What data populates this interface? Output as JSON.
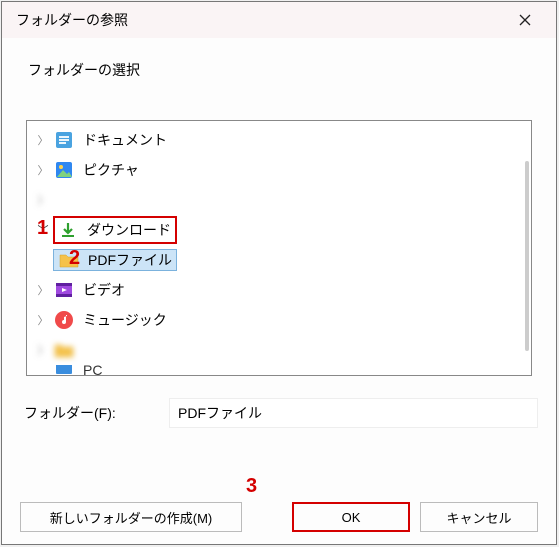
{
  "titlebar": {
    "title": "フォルダーの参照"
  },
  "subtitle": "フォルダーの選択",
  "tree": [
    {
      "label": "ドキュメント",
      "icon": "document",
      "expander": "closed",
      "indent": 0
    },
    {
      "label": "ピクチャ",
      "icon": "pictures",
      "expander": "closed",
      "indent": 0
    },
    {
      "label": "　　　　　",
      "icon": "blank",
      "expander": "closed",
      "indent": 0,
      "blur": true
    },
    {
      "label": "ダウンロード",
      "icon": "download",
      "expander": "open",
      "indent": 0,
      "highlight": true,
      "annot": "1"
    },
    {
      "label": "PDFファイル",
      "icon": "folder",
      "expander": "none",
      "indent": 1,
      "selected": true,
      "annot": "2"
    },
    {
      "label": "ビデオ",
      "icon": "video",
      "expander": "closed",
      "indent": 0
    },
    {
      "label": "ミュージック",
      "icon": "music",
      "expander": "closed",
      "indent": 0
    },
    {
      "label": "　　　　",
      "icon": "folder",
      "expander": "closed",
      "indent": 0,
      "blur": true
    },
    {
      "label": "PC",
      "icon": "pc",
      "expander": "none",
      "indent": 0,
      "cut": true
    }
  ],
  "folder": {
    "label": "フォルダー(F):",
    "value": "PDFファイル"
  },
  "buttons": {
    "new_folder": "新しいフォルダーの作成(M)",
    "ok": "OK",
    "cancel": "キャンセル"
  },
  "annot3": "3"
}
